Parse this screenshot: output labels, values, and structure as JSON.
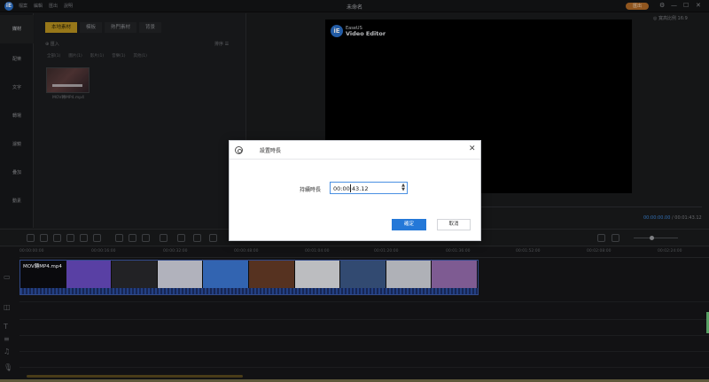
{
  "app": {
    "logo_letter": "iE",
    "menu": [
      "檔案",
      "編輯",
      "匯出",
      "說明"
    ],
    "title": "未命名",
    "export_label": "匯出",
    "window_controls": [
      "⚙",
      "—",
      "☐",
      "✕"
    ]
  },
  "sidenav": {
    "items": [
      "媒材",
      "配樂",
      "文字",
      "轉場",
      "濾鏡",
      "疊加",
      "動素"
    ]
  },
  "media": {
    "tabs": [
      "本地素材",
      "模板",
      "熱門素材",
      "背景"
    ],
    "import_label": "匯入",
    "sort_label": "排序",
    "filters": [
      "全部(1)",
      "圖片(1)",
      "影片(1)",
      "音樂(1)",
      "其他(1)"
    ],
    "clip_name": "MOV轉MP4.mp4"
  },
  "preview": {
    "brand_small": "EaseUS",
    "brand_large": "Video Editor",
    "ratio_label": "◎ 寬高比例 16:9",
    "time_current": "00:00:00.00",
    "time_separator": " / ",
    "time_total": "00:01:43.12"
  },
  "timeline": {
    "ticks": [
      "00:00:00:00",
      "00:00:16:00",
      "00:00:32:00",
      "00:00:48:00",
      "00:01:04:00",
      "00:01:20:00",
      "00:01:36:00",
      "00:01:52:00",
      "00:02:08:00",
      "00:02:24:00"
    ],
    "clip_label": "MOV轉MP4.mp4",
    "frame_colors": [
      "#0d0d10",
      "#6d4fc9",
      "#2a2a2e",
      "#d8dae6",
      "#3d7ad8",
      "#6a3e28",
      "#e6e7eb",
      "#3d5b8a",
      "#d6d8e0",
      "#9a6fb3"
    ]
  },
  "dialog": {
    "title": "設置時長",
    "close_glyph": "✕",
    "duration_label": "持續時長",
    "duration_value": "00:00:43.12",
    "spin_up": "▲",
    "spin_down": "▼",
    "ok_label": "確定",
    "cancel_label": "取消"
  }
}
